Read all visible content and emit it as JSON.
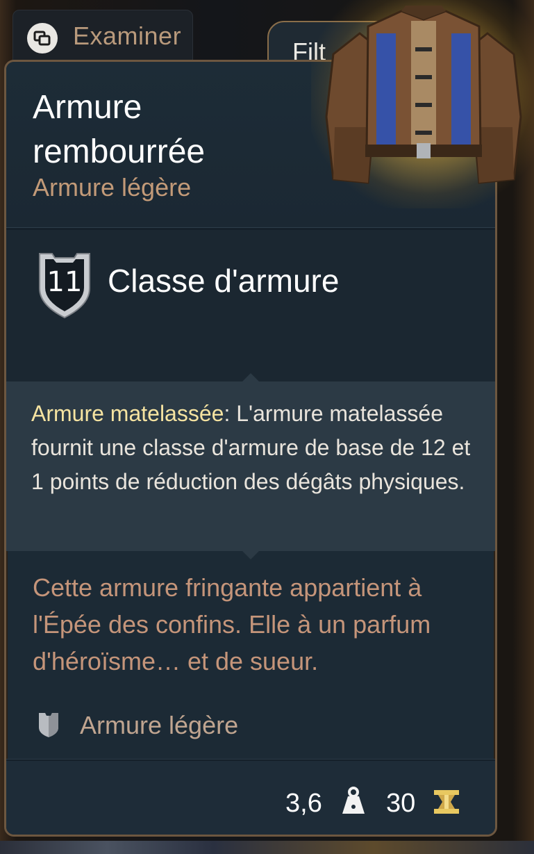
{
  "tabs": {
    "examine_label": "Examiner",
    "filter_label": "Filt"
  },
  "item": {
    "name": "Armure rembourrée",
    "type": "Armure légère",
    "rarity_glow": "#f2c35a"
  },
  "armor_class": {
    "value": "11",
    "label": "Classe d'armure"
  },
  "passive": {
    "name": "Armure matelassée",
    "separator": ": ",
    "description": "L'armure matelassée fournit une classe d'armure de base de 12 et 1 points de réduction des dégâts physiques."
  },
  "flavor_text": "Cette armure fringante appartient à l'Épée des confins. Elle à un parfum d'héroïsme… et de sueur.",
  "tag": {
    "icon": "light-armor-icon",
    "label": "Armure légère"
  },
  "footer": {
    "weight": "3,6",
    "weight_icon": "weight-icon",
    "price": "30",
    "price_icon": "gold-icon"
  }
}
